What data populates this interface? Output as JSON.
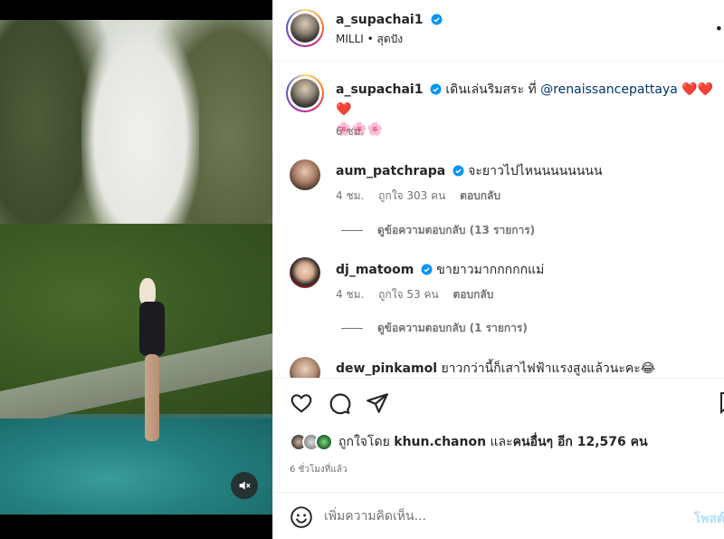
{
  "post": {
    "author": "a_supachai1",
    "audio": "MILLI • สุดปัง",
    "caption_text": "เดินเล่นริมสระ ที่ ",
    "caption_mention": "@renaissancepattaya",
    "caption_hearts": "❤️❤️❤️",
    "caption_flowers": "🌸🌸🌸",
    "caption_time": "6 ชม."
  },
  "comments": [
    {
      "username": "aum_patchrapa",
      "text": "จะยาวไปไหนนนนนนนน",
      "time": "4 ชม.",
      "likes": "ถูกใจ 303 คน",
      "reply": "ตอบกลับ",
      "view_replies": "ดูข้อความตอบกลับ (13 รายการ)"
    },
    {
      "username": "dj_matoom",
      "text": "ขายาวมากกกกกแม่",
      "time": "4 ชม.",
      "likes": "ถูกใจ 53 คน",
      "reply": "ตอบกลับ",
      "view_replies": "ดูข้อความตอบกลับ (1 รายการ)"
    },
    {
      "username": "dew_pinkamol",
      "text": "ยาวกว่านี้ก็เสาไฟฟ้าแรงสูงแล้วนะคะ😂"
    }
  ],
  "likes_summary": {
    "prefix": "ถูกใจโดย ",
    "user": "khun.chanon",
    "middle": " และ",
    "rest": "คนอื่นๆ อีก 12,576 คน"
  },
  "post_time": "6 ชั่วโมงที่แล้ว",
  "composer": {
    "placeholder": "เพิ่มความคิดเห็น...",
    "post_label": "โพสต์"
  },
  "icons": {
    "like": "heart-outline-icon",
    "comment": "comment-bubble-icon",
    "share": "paper-plane-icon",
    "save": "bookmark-icon",
    "emoji": "emoji-smile-icon",
    "mute": "speaker-muted-icon",
    "verified": "verified-badge-icon"
  },
  "colors": {
    "verified": "#0095f6",
    "mention": "#00376b",
    "post_disabled": "#b2dffc"
  }
}
